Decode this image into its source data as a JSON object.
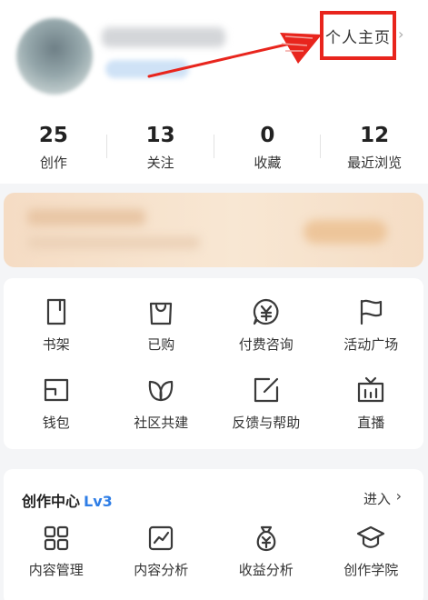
{
  "header": {
    "profile_link_label": "个人主页",
    "chevron": "›"
  },
  "stats": [
    {
      "value": "25",
      "label": "创作"
    },
    {
      "value": "13",
      "label": "关注"
    },
    {
      "value": "0",
      "label": "收藏"
    },
    {
      "value": "12",
      "label": "最近浏览"
    }
  ],
  "tools": [
    {
      "label": "书架",
      "icon": "bookshelf-icon"
    },
    {
      "label": "已购",
      "icon": "shopping-bag-icon"
    },
    {
      "label": "付费咨询",
      "icon": "paid-consult-icon"
    },
    {
      "label": "活动广场",
      "icon": "flag-icon"
    },
    {
      "label": "钱包",
      "icon": "wallet-icon"
    },
    {
      "label": "社区共建",
      "icon": "leaf-icon"
    },
    {
      "label": "反馈与帮助",
      "icon": "edit-icon"
    },
    {
      "label": "直播",
      "icon": "tv-icon"
    }
  ],
  "creator": {
    "title": "创作中心",
    "level": "Lv3",
    "enter_label": "进入",
    "chevron": "›",
    "items": [
      {
        "label": "内容管理",
        "icon": "grid-icon"
      },
      {
        "label": "内容分析",
        "icon": "chart-icon"
      },
      {
        "label": "收益分析",
        "icon": "money-bag-icon"
      },
      {
        "label": "创作学院",
        "icon": "graduation-cap-icon"
      }
    ]
  },
  "annotation_color": "#e8251d",
  "accent_color": "#2f7ee6"
}
